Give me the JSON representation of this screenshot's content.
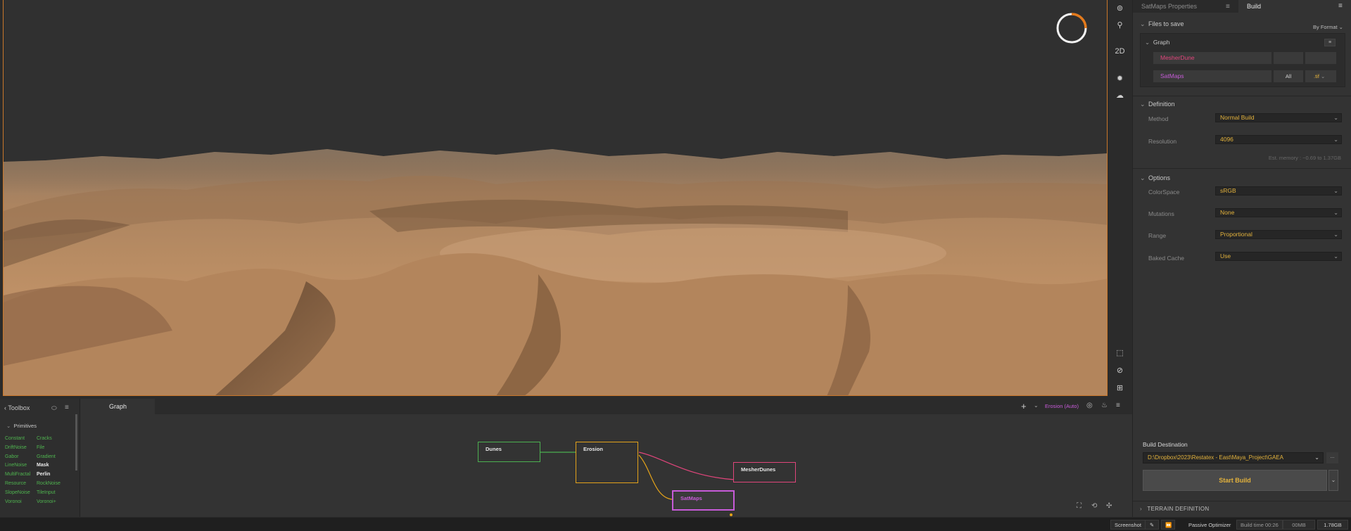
{
  "viewport": {
    "mode_label": "2D"
  },
  "properties": {
    "tabs": [
      {
        "label": "SatMaps Properties"
      },
      {
        "label": "Build"
      }
    ],
    "files_to_save": {
      "title": "Files to save",
      "by_format_label": "By Format",
      "graph_title": "Graph",
      "entries": [
        {
          "name": "MesherDune",
          "color": "#e0457b"
        },
        {
          "name": "SatMaps",
          "color": "#c75bd8",
          "channel": "All",
          "format": ".tif"
        }
      ]
    },
    "definition": {
      "title": "Definition",
      "method_label": "Method",
      "method_value": "Normal Build",
      "resolution_label": "Resolution",
      "resolution_value": "4096",
      "memory_estimate": "Est. memory : ~0.69 to 1.37GB"
    },
    "options": {
      "title": "Options",
      "colorspace_label": "ColorSpace",
      "colorspace_value": "sRGB",
      "mutations_label": "Mutations",
      "mutations_value": "None",
      "range_label": "Range",
      "range_value": "Proportional",
      "baked_cache_label": "Baked Cache",
      "baked_cache_value": "Use"
    },
    "build_destination": {
      "label": "Build Destination",
      "path": "D:\\Dropbox\\2023\\Restatex - East\\Maya_Project\\GAEA",
      "more_label": "...",
      "start_build_label": "Start Build"
    },
    "terrain_definition_label": "TERRAIN DEFINITION"
  },
  "toolbox": {
    "title": "Toolbox",
    "category": "Primitives",
    "col1": [
      "Constant",
      "DriftNoise",
      "Gabor",
      "LineNoise",
      "MultiFractal",
      "Resource",
      "SlopeNoise",
      "Voronoi"
    ],
    "col2": [
      "Cracks",
      "File",
      "Gradient",
      "Mask",
      "Perlin",
      "RockNoise",
      "TileInput",
      "Voronoi+"
    ],
    "highlighted": [
      "Mask",
      "Perlin"
    ]
  },
  "graph": {
    "tab_label": "Graph",
    "erosion_auto_label": "Erosion (Auto)",
    "nodes": [
      {
        "label": "Dunes",
        "color": "#4caf50"
      },
      {
        "label": "Erosion",
        "color": "#e3a21a"
      },
      {
        "label": "MesherDunes",
        "color": "#e0457b"
      },
      {
        "label": "SatMaps",
        "color": "#c75bd8"
      }
    ]
  },
  "statusbar": {
    "screenshot": "Screenshot",
    "passive_optimizer": "Passive Optimizer",
    "build_time": "Build time 00:26",
    "mem1": "00MB",
    "mem2": "1.78GB"
  },
  "colors": {
    "accent_orange": "#c9772a",
    "value_yellow": "#e3b23c",
    "toolbox_green": "#4fb34f"
  }
}
